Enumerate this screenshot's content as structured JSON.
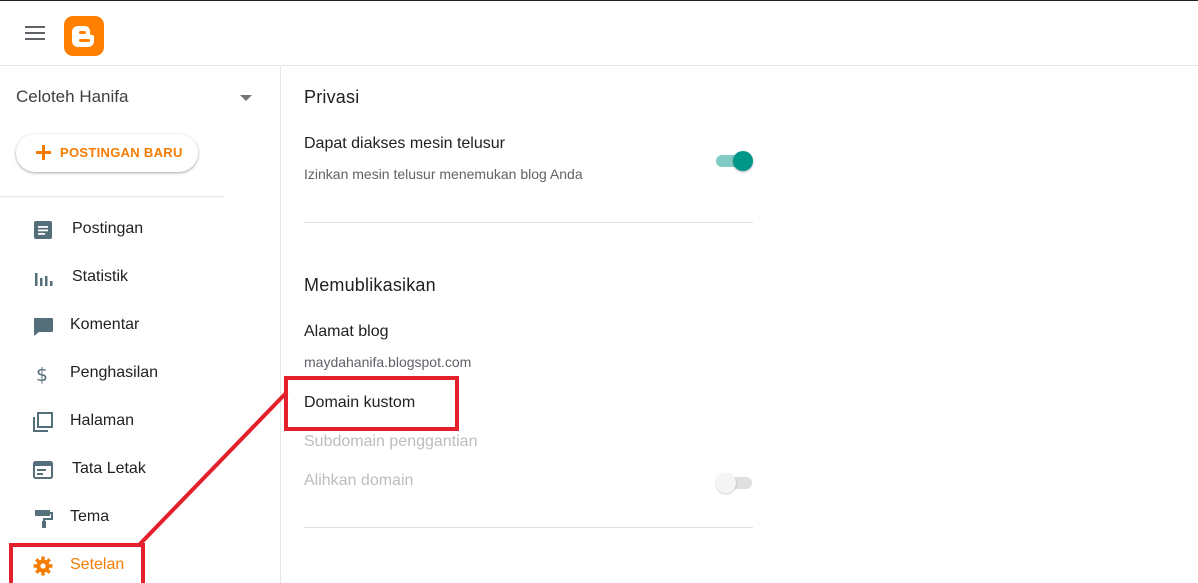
{
  "header": {
    "menu_icon": "hamburger-menu-icon",
    "logo_icon": "blogger-logo-icon",
    "brand_color": "#ff8000"
  },
  "sidebar": {
    "blog_name": "Celoteh Hanifa",
    "new_post_label": "POSTINGAN BARU",
    "accent_color": "#f57c00",
    "items": [
      {
        "label": "Postingan",
        "icon": "posts-icon"
      },
      {
        "label": "Statistik",
        "icon": "stats-icon"
      },
      {
        "label": "Komentar",
        "icon": "comment-icon"
      },
      {
        "label": "Penghasilan",
        "icon": "dollar-icon"
      },
      {
        "label": "Halaman",
        "icon": "pages-icon"
      },
      {
        "label": "Tata Letak",
        "icon": "layout-icon"
      },
      {
        "label": "Tema",
        "icon": "paint-roller-icon"
      },
      {
        "label": "Setelan",
        "icon": "gear-icon",
        "active": true
      }
    ]
  },
  "main": {
    "privacy": {
      "title": "Privasi",
      "search_visible_title": "Dapat diakses mesin telusur",
      "search_visible_desc": "Izinkan mesin telusur menemukan blog Anda",
      "search_visible_on": true
    },
    "publishing": {
      "title": "Memublikasikan",
      "blog_address_label": "Alamat blog",
      "blog_address_value": "maydahanifa.blogspot.com",
      "custom_domain_label": "Domain kustom",
      "fallback_subdomain_label": "Subdomain penggantian",
      "redirect_domain_label": "Alihkan domain",
      "redirect_domain_on": false
    }
  },
  "annotation": {
    "highlight_color": "#e3202b"
  }
}
